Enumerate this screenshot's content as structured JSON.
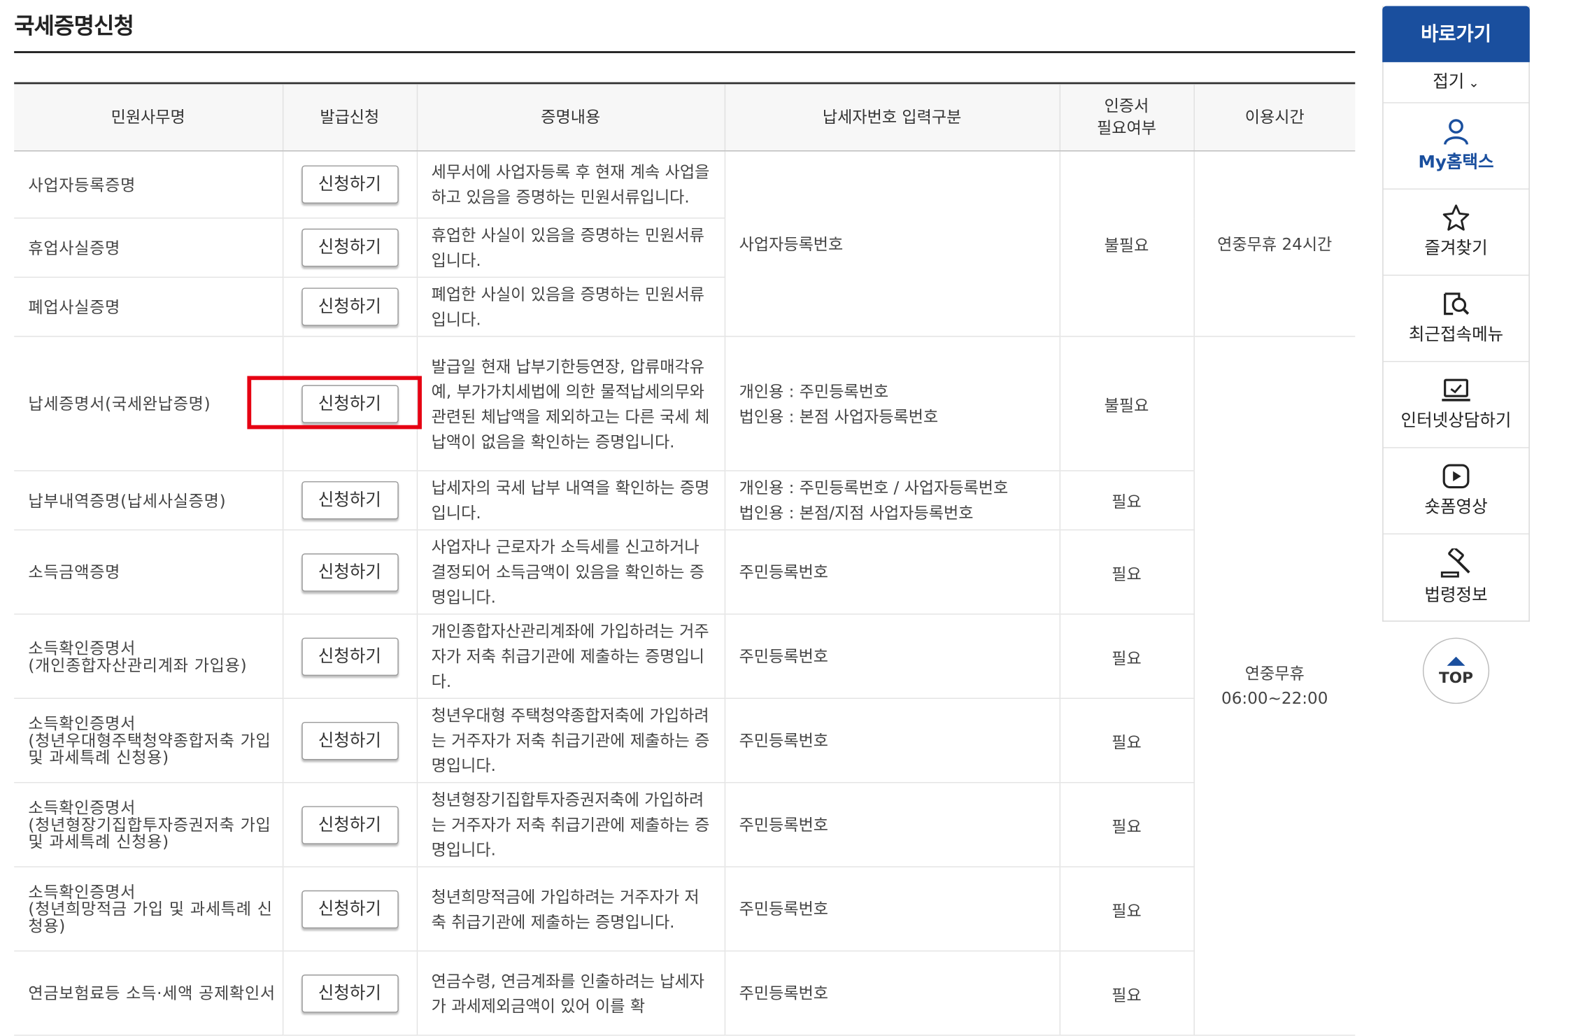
{
  "page": {
    "title": "국세증명신청"
  },
  "table": {
    "headers": [
      "민원사무명",
      "발급신청",
      "증명내용",
      "납세자번호 입력구분",
      "인증서\n필요여부",
      "이용시간"
    ],
    "apply_label": "신청하기",
    "groups": {
      "business_input": "사업자등록번호",
      "business_cert": "불필요",
      "time_all_day": "연중무휴 24시간",
      "time_day_line1": "연중무휴",
      "time_day_line2": "06:00~22:00"
    },
    "rows": [
      {
        "name": "사업자등록증명",
        "desc": "세무서에 사업자등록 후 현재 계속 사업을 하고 있음을 증명하는 민원서류입니다."
      },
      {
        "name": "휴업사실증명",
        "desc": "휴업한 사실이 있음을 증명하는 민원서류입니다."
      },
      {
        "name": "폐업사실증명",
        "desc": "폐업한 사실이 있음을 증명하는 민원서류입니다."
      },
      {
        "name": "납세증명서(국세완납증명)",
        "desc": "발급일 현재 납부기한등연장, 압류매각유예, 부가가치세법에 의한 물적납세의무와 관련된 체납액을 제외하고는 다른 국세 체납액이 없음을 확인하는 증명입니다.",
        "input_line1": "개인용 : 주민등록번호",
        "input_line2": "법인용 : 본점 사업자등록번호",
        "cert": "불필요"
      },
      {
        "name": "납부내역증명(납세사실증명)",
        "desc": "납세자의 국세 납부 내역을 확인하는 증명입니다.",
        "input_line1": "개인용 : 주민등록번호 / 사업자등록번호",
        "input_line2": "법인용 : 본점/지점 사업자등록번호",
        "cert": "필요"
      },
      {
        "name": "소득금액증명",
        "desc": "사업자나 근로자가 소득세를 신고하거나 결정되어 소득금액이 있음을 확인하는 증명입니다.",
        "input": "주민등록번호",
        "cert": "필요"
      },
      {
        "name_line1": "소득확인증명서",
        "name_line2": "(개인종합자산관리계좌 가입용)",
        "desc": "개인종합자산관리계좌에 가입하려는 거주자가 저축 취급기관에 제출하는 증명입니다.",
        "input": "주민등록번호",
        "cert": "필요"
      },
      {
        "name_line1": "소득확인증명서",
        "name_line2": "(청년우대형주택청약종합저축 가입 및 과세특례 신청용)",
        "desc": "청년우대형 주택청약종합저축에 가입하려는 거주자가 저축 취급기관에 제출하는 증명입니다.",
        "input": "주민등록번호",
        "cert": "필요"
      },
      {
        "name_line1": "소득확인증명서",
        "name_line2": "(청년형장기집합투자증권저축 가입 및 과세특례 신청용)",
        "desc": "청년형장기집합투자증권저축에 가입하려는 거주자가 저축 취급기관에 제출하는 증명입니다.",
        "input": "주민등록번호",
        "cert": "필요"
      },
      {
        "name_line1": "소득확인증명서",
        "name_line2": "(청년희망적금 가입 및 과세특례 신청용)",
        "desc": "청년희망적금에 가입하려는 거주자가 저축 취급기관에 제출하는 증명입니다.",
        "input": "주민등록번호",
        "cert": "필요"
      },
      {
        "name": "연금보험료등 소득·세액 공제확인서",
        "desc": "연금수령, 연금계좌를 인출하려는 납세자가 과세제외금액이 있어 이를 확",
        "input": "주민등록번호",
        "cert": "필요"
      }
    ]
  },
  "quick_menu": {
    "title": "바로가기",
    "fold": "접기",
    "items": [
      "My홈택스",
      "즐겨찾기",
      "최근접속메뉴",
      "인터넷상담하기",
      "숏폼영상",
      "법령정보"
    ],
    "top": "TOP"
  },
  "colors": {
    "accent": "#1a4f9e",
    "link": "#2a6cc4",
    "highlight": "#e60012"
  }
}
